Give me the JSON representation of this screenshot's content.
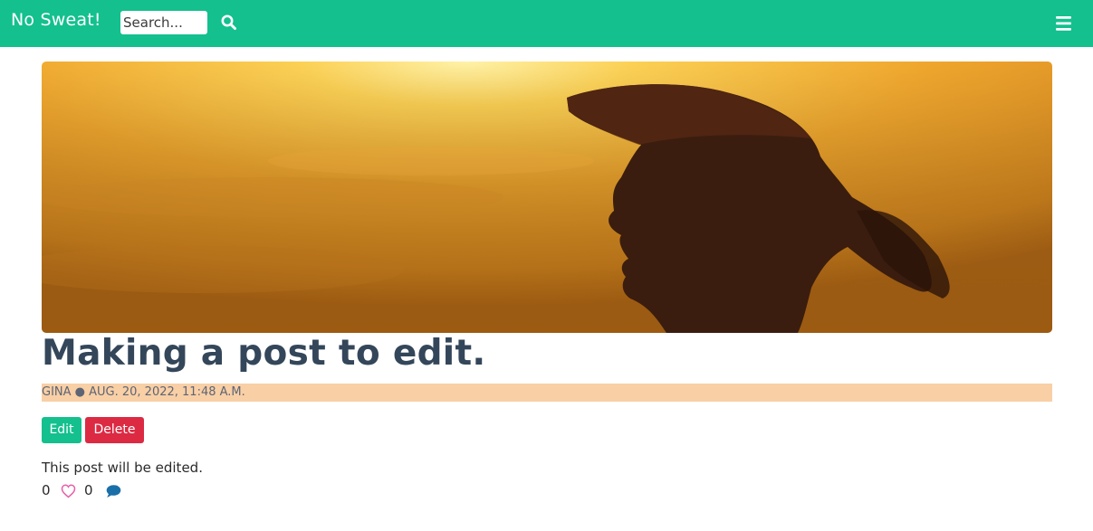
{
  "navbar": {
    "brand": "No Sweat!",
    "search_placeholder": "Search...",
    "search_icon": "search-icon",
    "menu_icon": "hamburger-menu-icon",
    "background": "#13c08e"
  },
  "post": {
    "image_description_icon": "hero-photo",
    "title": "Making a post to edit.",
    "meta": "GINA ● AUG. 20, 2022, 11:48 A.M.",
    "edit_label": "Edit",
    "delete_label": "Delete",
    "body": "This post will be edited.",
    "likes": "0",
    "comments": "0",
    "like_icon": "heart-outline-icon",
    "comment_icon": "comment-icon"
  },
  "colors": {
    "accent": "#13c08e",
    "danger": "#dc2a43",
    "meta_background": "#f9cfa6",
    "heart": "#e75fa8",
    "comment": "#1a6fa8"
  }
}
